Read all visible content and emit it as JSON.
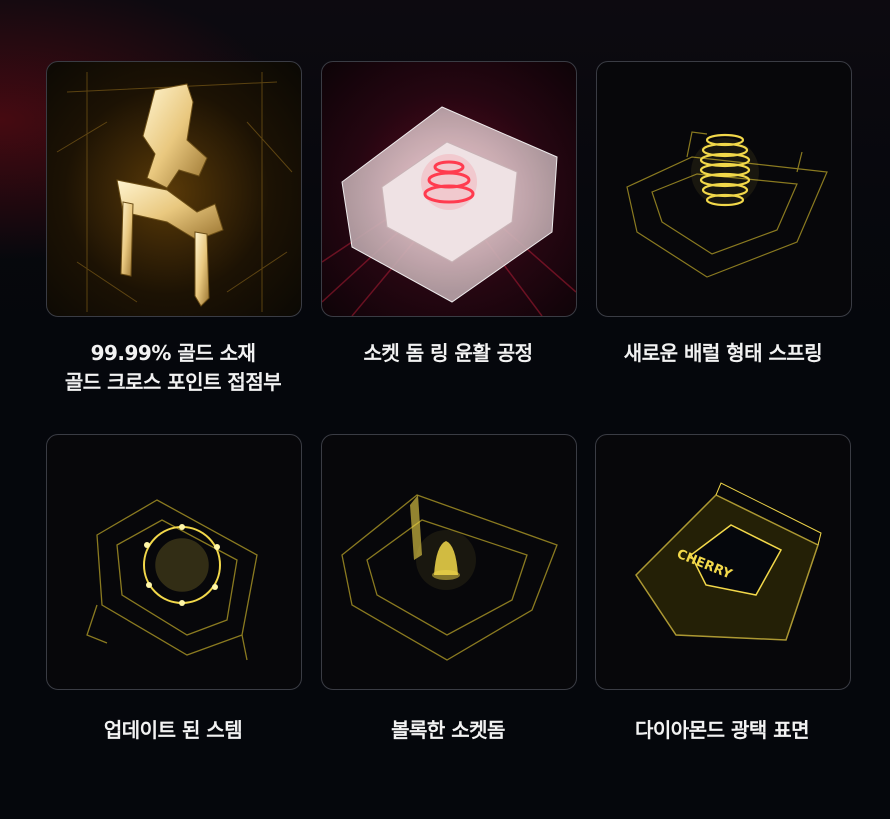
{
  "features": [
    {
      "id": "gold-contact",
      "lines": [
        "99.99% 골드 소재",
        "골드 크로스 포인트 접점부"
      ]
    },
    {
      "id": "socket-dome-lube",
      "lines": [
        "소켓 돔 링 윤활 공정"
      ]
    },
    {
      "id": "spring",
      "lines": [
        "새로운 배럴 형태 스프링"
      ]
    },
    {
      "id": "stem",
      "lines": [
        "업데이트 된 스템"
      ]
    },
    {
      "id": "socket-dome",
      "lines": [
        "볼록한 소켓돔"
      ]
    },
    {
      "id": "housing",
      "lines": [
        "다이아몬드 광택 표면"
      ]
    }
  ],
  "colors": {
    "background": "#05070c",
    "card_border": "#3a3c44",
    "gold": "#e8c15a",
    "red_glow": "#ff3b4f",
    "text": "#f2f2f2"
  },
  "images": [
    "gold-contact-illustration",
    "socket-dome-ring-illustration",
    "barrel-spring-illustration",
    "stem-illustration",
    "convex-socket-dome-illustration",
    "diamond-surface-housing-illustration"
  ]
}
